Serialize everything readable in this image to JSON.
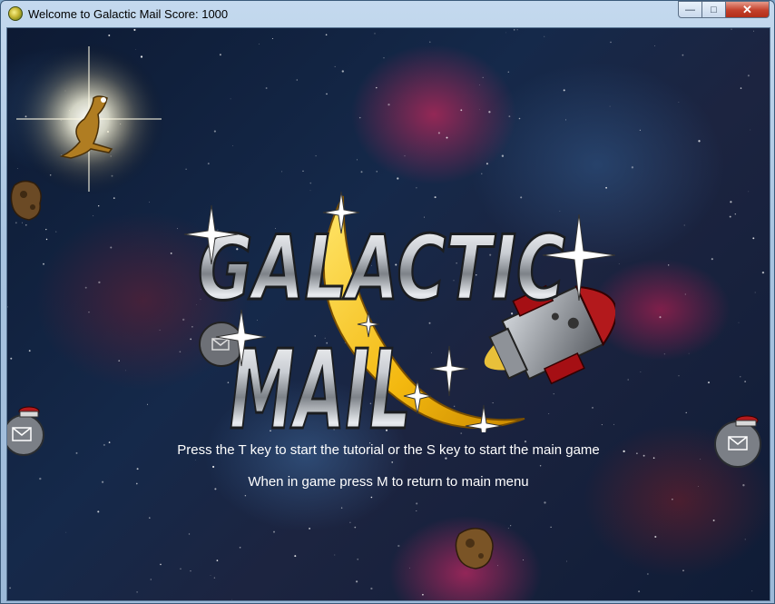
{
  "window": {
    "title": "Welcome to Galactic Mail Score: 1000",
    "minimize_glyph": "—",
    "maximize_glyph": "□",
    "close_glyph": "✕"
  },
  "logo": {
    "line1": "GALACTIC",
    "line2": "MAIL"
  },
  "menu": {
    "instruction_line_1": "Press the T key to start the tutorial or the S key to start the main game",
    "instruction_line_2": "When in game press M to return to main menu"
  },
  "icons": [
    "app-icon",
    "minimize-icon",
    "maximize-icon",
    "close-icon",
    "alien-sprite",
    "asteroid-sprite",
    "moon-with-mail-sprite",
    "rocket-sprite",
    "sparkle-star"
  ],
  "colors": {
    "text": "#ffffff",
    "logo_silver": "#d9dde3",
    "moon_yellow": "#f5c21a",
    "rocket_red": "#b3191c",
    "close_red": "#c3402b"
  }
}
